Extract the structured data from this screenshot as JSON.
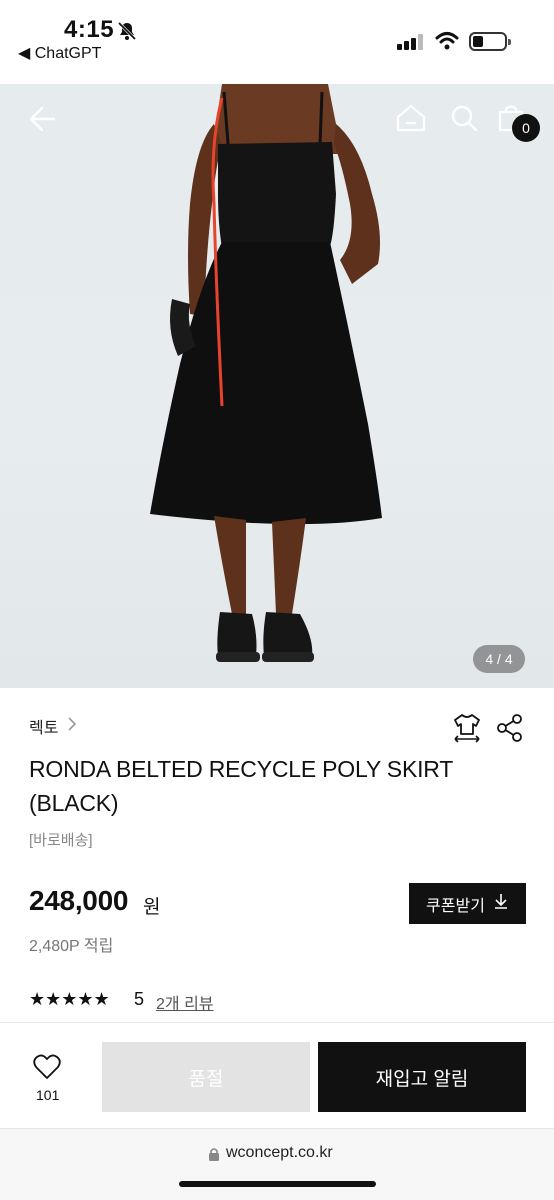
{
  "status": {
    "time": "4:15",
    "back_app": "◀ ChatGPT"
  },
  "hero": {
    "image_counter": "4 / 4",
    "cart_count": "0"
  },
  "product": {
    "brand": "렉토",
    "title": "RONDA BELTED RECYCLE POLY SKIRT (BLACK)",
    "delivery_tag": "[바로배송]",
    "price": "248,000",
    "currency": "원",
    "points": "2,480P 적립",
    "coupon_label": "쿠폰받기",
    "stars": "★★★★★",
    "rating": "5",
    "reviews_label": "2개 리뷰"
  },
  "bottom": {
    "wish_count": "101",
    "soldout_label": "품절",
    "restock_label": "재입고 알림"
  },
  "browser": {
    "url": "wconcept.co.kr"
  },
  "colors": {
    "accent": "#111111",
    "soldout_bg": "#e3e3e3",
    "hero_bg": "#e6ebed"
  }
}
